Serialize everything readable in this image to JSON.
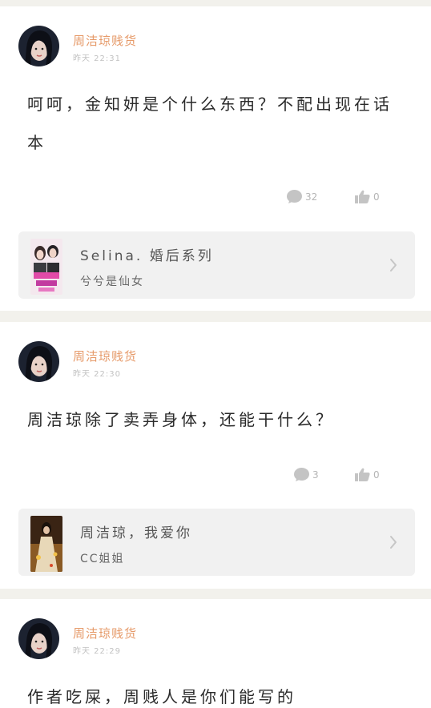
{
  "comments": [
    {
      "username": "周洁琼贱货",
      "time": "昨天 22:31",
      "content": "呵呵，金知妍是个什么东西？不配出现在话本",
      "reply_count": "32",
      "like_count": "0",
      "book": {
        "title": "Selina. 婚后系列",
        "author": "兮兮是仙女"
      }
    },
    {
      "username": "周洁琼贱货",
      "time": "昨天 22:30",
      "content": "周洁琼除了卖弄身体，还能干什么？",
      "reply_count": "3",
      "like_count": "0",
      "book": {
        "title": "周洁琼，我爱你",
        "author": "CC姐姐"
      }
    },
    {
      "username": "周洁琼贱货",
      "time": "昨天 22:29",
      "content": "作者吃屎，周贱人是你们能写的"
    }
  ],
  "colors": {
    "username": "#e69a69",
    "book_bg": "#f1f1f1",
    "page_bg": "#f2f1ec"
  },
  "icons": {
    "reply": "comment-bubble-icon",
    "like": "thumbs-up-icon",
    "open": "chevron-right-icon"
  }
}
